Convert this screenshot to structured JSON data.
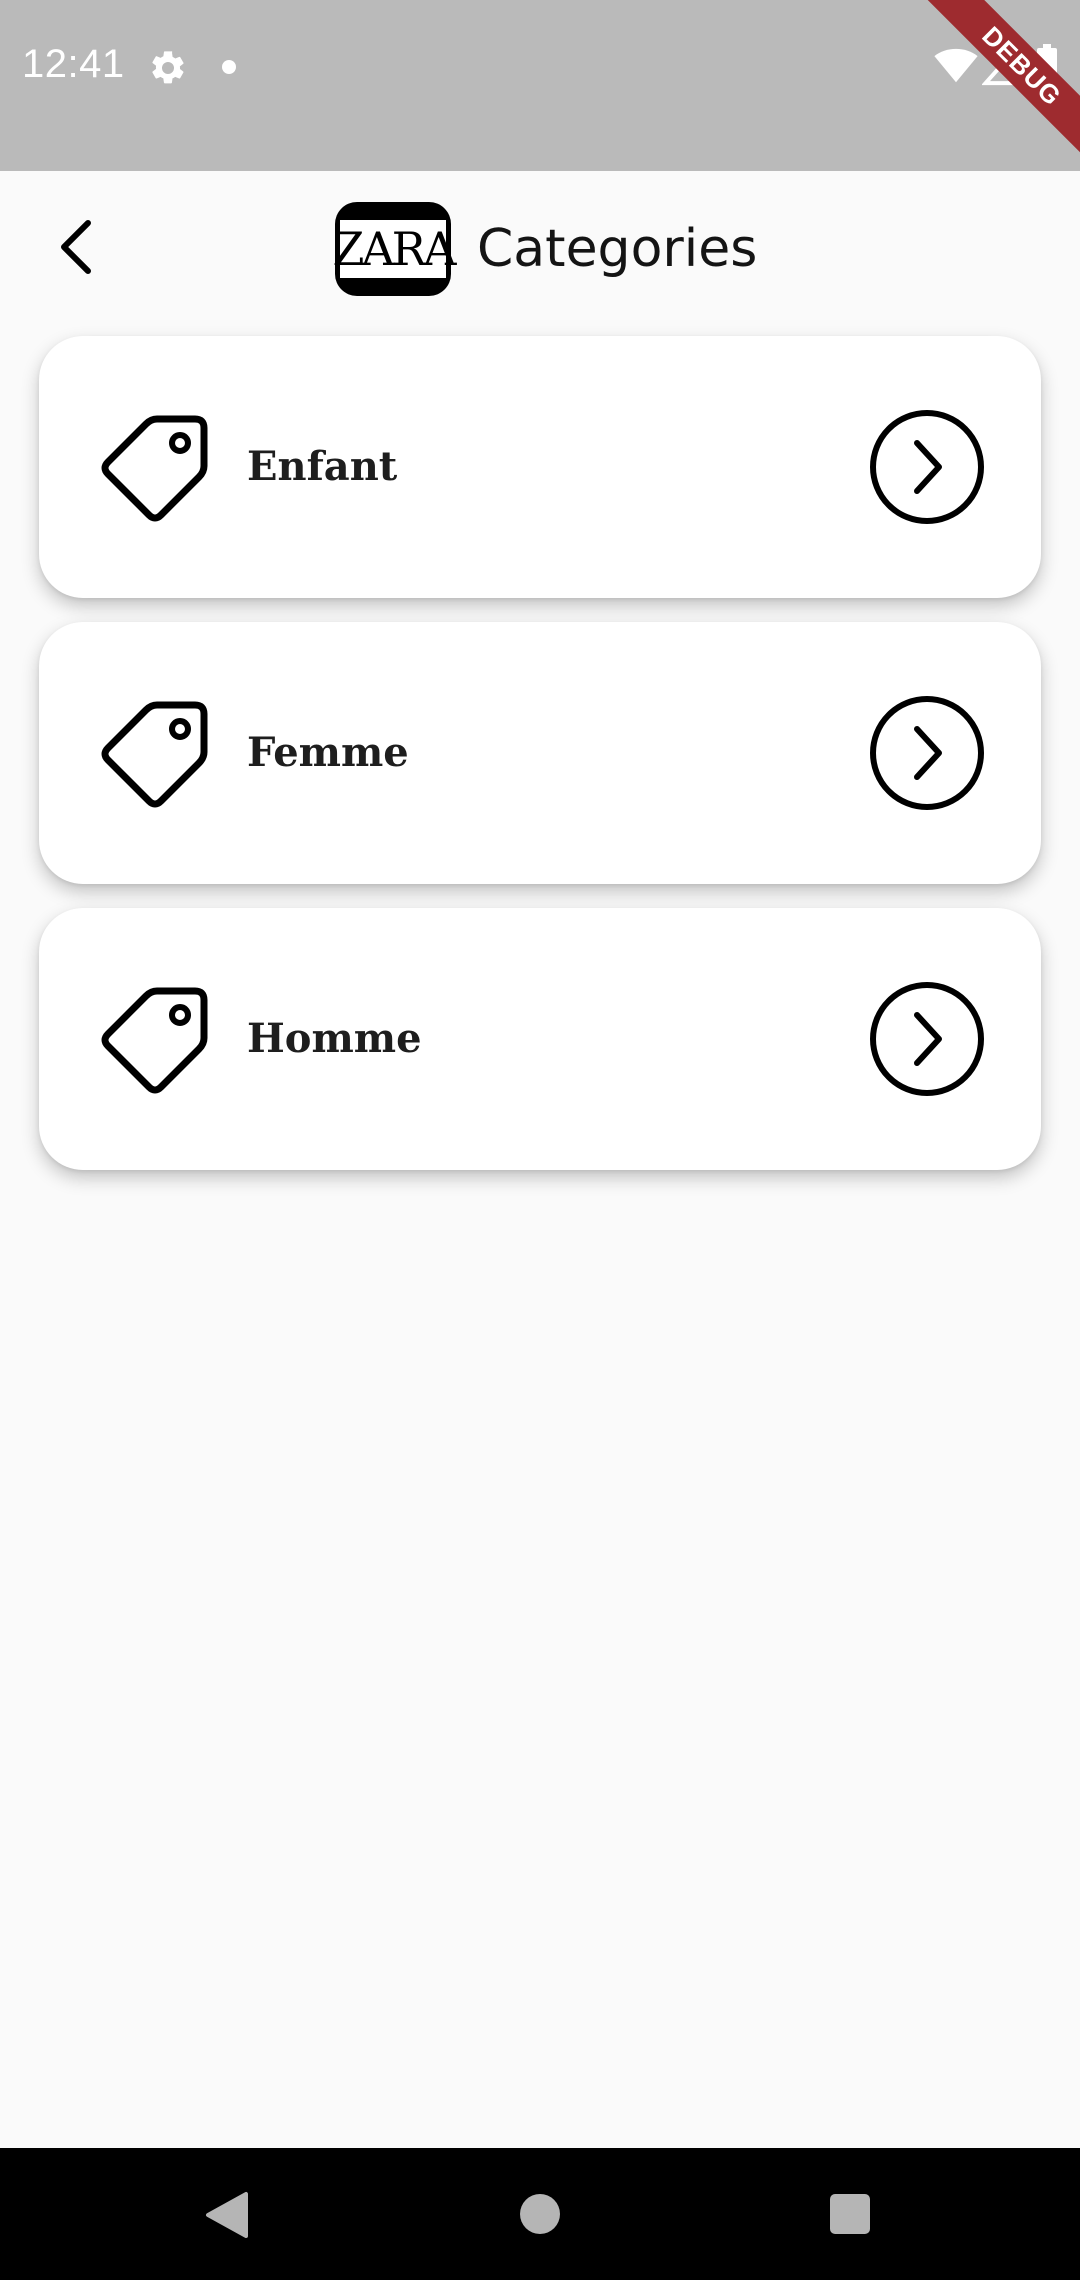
{
  "status_bar": {
    "time": "12:41",
    "icons": [
      "settings-icon",
      "notification-dot",
      "wifi-icon",
      "signal-icon",
      "battery-icon"
    ]
  },
  "debug_banner": {
    "label": "DEBUG",
    "color": "#9e2b2f"
  },
  "app_bar": {
    "back_icon": "chevron-left-icon",
    "logo_text": "ZARA",
    "title": "Categories"
  },
  "categories": [
    {
      "label": "Enfant",
      "icon": "tag-icon",
      "action_icon": "chevron-right-circle-icon"
    },
    {
      "label": "Femme",
      "icon": "tag-icon",
      "action_icon": "chevron-right-circle-icon"
    },
    {
      "label": "Homme",
      "icon": "tag-icon",
      "action_icon": "chevron-right-circle-icon"
    }
  ],
  "nav_bar": {
    "icons": [
      "nav-back-icon",
      "nav-home-icon",
      "nav-recents-icon"
    ]
  },
  "colors": {
    "status_bar": "#bababa",
    "background": "#fafafa",
    "card": "#ffffff",
    "text": "#1e1e1e",
    "nav_bar": "#000000"
  }
}
